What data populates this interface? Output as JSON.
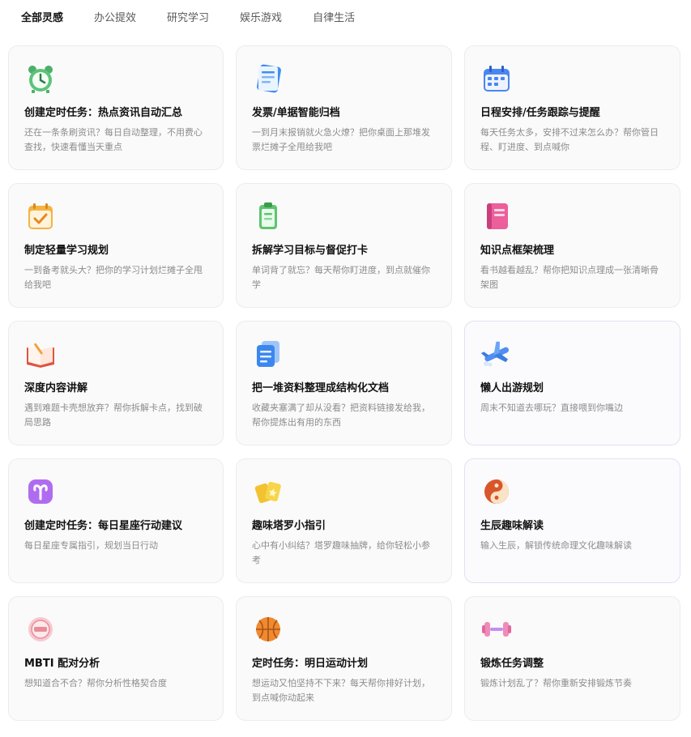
{
  "tabs": [
    "全部灵感",
    "办公提效",
    "研究学习",
    "娱乐游戏",
    "自律生活"
  ],
  "cards": [
    {
      "icon": "alarm-clock-icon",
      "title": "创建定时任务：热点资讯自动汇总",
      "desc": "还在一条条刷资讯？每日自动整理，不用费心查找，快速看懂当天重点"
    },
    {
      "icon": "receipt-icon",
      "title": "发票/单据智能归档",
      "desc": "一到月末报销就火急火燎？把你桌面上那堆发票烂摊子全甩给我吧"
    },
    {
      "icon": "calendar-icon",
      "title": "日程安排/任务跟踪与提醒",
      "desc": "每天任务太多，安排不过来怎么办？帮你管日程、盯进度、到点喊你"
    },
    {
      "icon": "checklist-icon",
      "title": "制定轻量学习规划",
      "desc": "一到备考就头大？把你的学习计划烂摊子全甩给我吧"
    },
    {
      "icon": "clipboard-icon",
      "title": "拆解学习目标与督促打卡",
      "desc": "单词背了就忘？每天帮你盯进度，到点就催你学"
    },
    {
      "icon": "notebook-icon",
      "title": "知识点框架梳理",
      "desc": "看书越看越乱？帮你把知识点理成一张清晰骨架图"
    },
    {
      "icon": "open-book-icon",
      "title": "深度内容讲解",
      "desc": "遇到难题卡壳想放弃？帮你拆解卡点，找到破局思路"
    },
    {
      "icon": "documents-icon",
      "title": "把一堆资料整理成结构化文档",
      "desc": "收藏夹塞满了却从没看？把资料链接发给我，帮你提炼出有用的东西"
    },
    {
      "icon": "airplane-icon",
      "title": "懒人出游规划",
      "desc": "周末不知道去哪玩？直接喂到你嘴边"
    },
    {
      "icon": "aries-icon",
      "title": "创建定时任务：每日星座行动建议",
      "desc": "每日星座专属指引，规划当日行动"
    },
    {
      "icon": "tarot-cards-icon",
      "title": "趣味塔罗小指引",
      "desc": "心中有小纠结？塔罗趣味抽牌，给你轻松小参考"
    },
    {
      "icon": "yin-yang-icon",
      "title": "生辰趣味解读",
      "desc": "输入生辰，解锁传统命理文化趣味解读"
    },
    {
      "icon": "mbti-badge-icon",
      "title": "MBTI 配对分析",
      "desc": "想知道合不合？帮你分析性格契合度"
    },
    {
      "icon": "basketball-icon",
      "title": "定时任务：明日运动计划",
      "desc": "想运动又怕坚持不下来？每天帮你排好计划，到点喊你动起来"
    },
    {
      "icon": "dumbbell-icon",
      "title": "锻炼任务调整",
      "desc": "锻炼计划乱了？帮你重新安排锻炼节奏"
    }
  ]
}
